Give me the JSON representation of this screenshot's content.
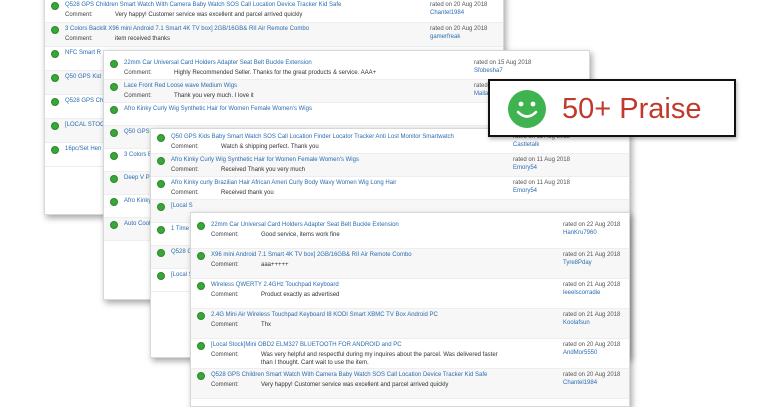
{
  "comment_label": "Comment:",
  "badge": {
    "text": "50+ Praise",
    "icon": "smiley-face-icon",
    "color": "#c0392b"
  },
  "sheet1": [
    {
      "title": "Q528 GPS Children Smart Watch With Camera Baby Watch SOS Call Location Device Tracker Kid Safe",
      "comment": "Very happy! Customer service was excellent and parcel arrived quickly",
      "rated": "rated on 20 Aug 2018",
      "user": "Chantel1984"
    },
    {
      "title": "3 Colors Backlit X96 mini Android 7.1 Smart 4K TV box] 2GB/16GB& RII Air Remote Combo",
      "comment": "item received thanks",
      "rated": "rated on 20 Aug 2018",
      "user": "gamerfreak"
    },
    {
      "title": "NFC Smart R",
      "comment": "",
      "rated": "",
      "user": ""
    },
    {
      "title": "Q50 GPS Kid",
      "comment": "",
      "rated": "",
      "user": ""
    },
    {
      "title": "Q528 GPS Ch",
      "comment": "",
      "rated": "",
      "user": ""
    },
    {
      "title": "[LOCAL STOC",
      "comment": "",
      "rated": "",
      "user": ""
    },
    {
      "title": "16pc/Set Hen",
      "comment": "",
      "rated": "",
      "user": ""
    }
  ],
  "sheet2": [
    {
      "title": "22mm Car Universal Card Holders Adapter Seat Belt Buckle Extension",
      "comment": "Highly Recommended Seller. Thanks for the great products & service. AAA+",
      "rated": "rated on 15 Aug 2018",
      "user": "Sfobesha7"
    },
    {
      "title": "Lace Front Red Loose wave Medium Wigs",
      "comment": "Thank you very much. I love it",
      "rated": "rated on 11 Aug 2018",
      "user": "Mallan"
    },
    {
      "title": "Afro Kinky Curly Wig Synthetic Hair for Women Female Women's Wigs",
      "comment": "",
      "rated": "",
      "user": ""
    },
    {
      "title": "Q50 GPS I",
      "comment": "",
      "rated": "",
      "user": ""
    },
    {
      "title": "3 Colors B",
      "comment": "",
      "rated": "",
      "user": ""
    },
    {
      "title": "Deep V Pl",
      "comment": "",
      "rated": "",
      "user": ""
    },
    {
      "title": "Afro Kinky",
      "comment": "",
      "rated": "",
      "user": ""
    },
    {
      "title": "Auto Cool",
      "comment": "",
      "rated": "",
      "user": ""
    }
  ],
  "sheet3": [
    {
      "title": "Q50 GPS Kids Baby Smart Watch SOS Call Location Finder Locator Tracker Anti Lost Monitor Smartwatch",
      "comment": "Watch & shipping perfect. Thank you",
      "rated": "rated on 11 Aug 2018",
      "user": "Castletalk"
    },
    {
      "title": "Afro Kinky Curly Wig Synthetic Hair for Women Female Women's Wigs",
      "comment": "Received Thank you very much",
      "rated": "rated on 11 Aug 2018",
      "user": "Emory54"
    },
    {
      "title": "Afro Kinky curly Brazilian Hair African Ameri Curly Body Wavy Women Wig Long Hair",
      "comment": "Received thank you",
      "rated": "rated on 11 Aug 2018",
      "user": "Emory54"
    },
    {
      "title": "[Local S",
      "comment": "",
      "rated": "",
      "user": ""
    },
    {
      "title": "1 Time L",
      "comment": "",
      "rated": "",
      "user": ""
    },
    {
      "title": "Q528 G",
      "comment": "",
      "rated": "",
      "user": ""
    },
    {
      "title": "[Local S",
      "comment": "",
      "rated": "",
      "user": ""
    }
  ],
  "sheet4": [
    {
      "title": "22mm Car Universal Card Holders Adapter Seat Belt Buckle Extension",
      "comment": "Good service, items work fine",
      "rated": "rated on 22 Aug 2018",
      "user": "HanKru7960"
    },
    {
      "title": "X96 mini Android 7.1 Smart 4K TV box] 2GB/16GB& RII Air Remote Combo",
      "comment": "aaa+++++",
      "rated": "rated on 21 Aug 2018",
      "user": "Tyre8Pday"
    },
    {
      "title": "Wireless QWERTY 2.4GHz Touchpad Keyboard",
      "comment": "Product exactly as advertised",
      "rated": "rated on 21 Aug 2018",
      "user": "leeelscorradie"
    },
    {
      "title": "2.4G Mini Air Wireless Touchpad Keyboard I8 KODI Smart XBMC TV Box Android PC",
      "comment": "Thx",
      "rated": "rated on 21 Aug 2018",
      "user": "Koolafsun"
    },
    {
      "title": "[Local Stock]Mini OBD2 ELM327 BLUETOOTH FOR ANDROID and PC",
      "comment": "Was very helpful and respectful during my inquires about the parcel. Was delivered faster than I thought. Cant wait to use the item.",
      "rated": "rated on 20 Aug 2018",
      "user": "AndMor5550"
    },
    {
      "title": "Q528 GPS Children Smart Watch With Camera Baby Watch SOS Call Location Device Tracker Kid Safe",
      "comment": "Very happy! Customer service was excellent and parcel arrived quickly",
      "rated": "rated on 20 Aug 2018",
      "user": "Chantel1984"
    }
  ]
}
